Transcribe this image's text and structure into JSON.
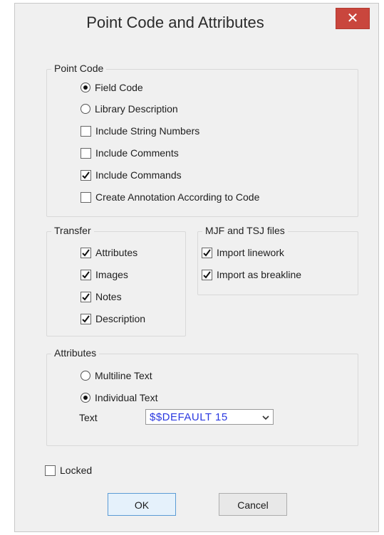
{
  "dialog": {
    "title": "Point Code and Attributes",
    "close_glyph": "✕"
  },
  "point_code": {
    "title": "Point Code",
    "field_code": {
      "label": "Field Code",
      "selected": true
    },
    "library_description": {
      "label": "Library Description",
      "selected": false
    },
    "include_string_numbers": {
      "label": "Include String Numbers",
      "checked": false
    },
    "include_comments": {
      "label": "Include Comments",
      "checked": false
    },
    "include_commands": {
      "label": "Include Commands",
      "checked": true
    },
    "create_annotation": {
      "label": "Create Annotation According to Code",
      "checked": false
    }
  },
  "transfer": {
    "title": "Transfer",
    "attributes": {
      "label": "Attributes",
      "checked": true
    },
    "images": {
      "label": "Images",
      "checked": true
    },
    "notes": {
      "label": "Notes",
      "checked": true
    },
    "description": {
      "label": "Description",
      "checked": true
    }
  },
  "mjf": {
    "title": "MJF and TSJ files",
    "import_linework": {
      "label": "Import linework",
      "checked": true
    },
    "import_breakline": {
      "label": "Import as breakline",
      "checked": true
    }
  },
  "attributes": {
    "title": "Attributes",
    "multiline_text": {
      "label": "Multiline Text",
      "selected": false
    },
    "individual_text": {
      "label": "Individual Text",
      "selected": true
    },
    "text_label": "Text",
    "text_value": "$$DEFAULT  15"
  },
  "locked": {
    "label": "Locked",
    "checked": false
  },
  "buttons": {
    "ok": "OK",
    "cancel": "Cancel"
  }
}
